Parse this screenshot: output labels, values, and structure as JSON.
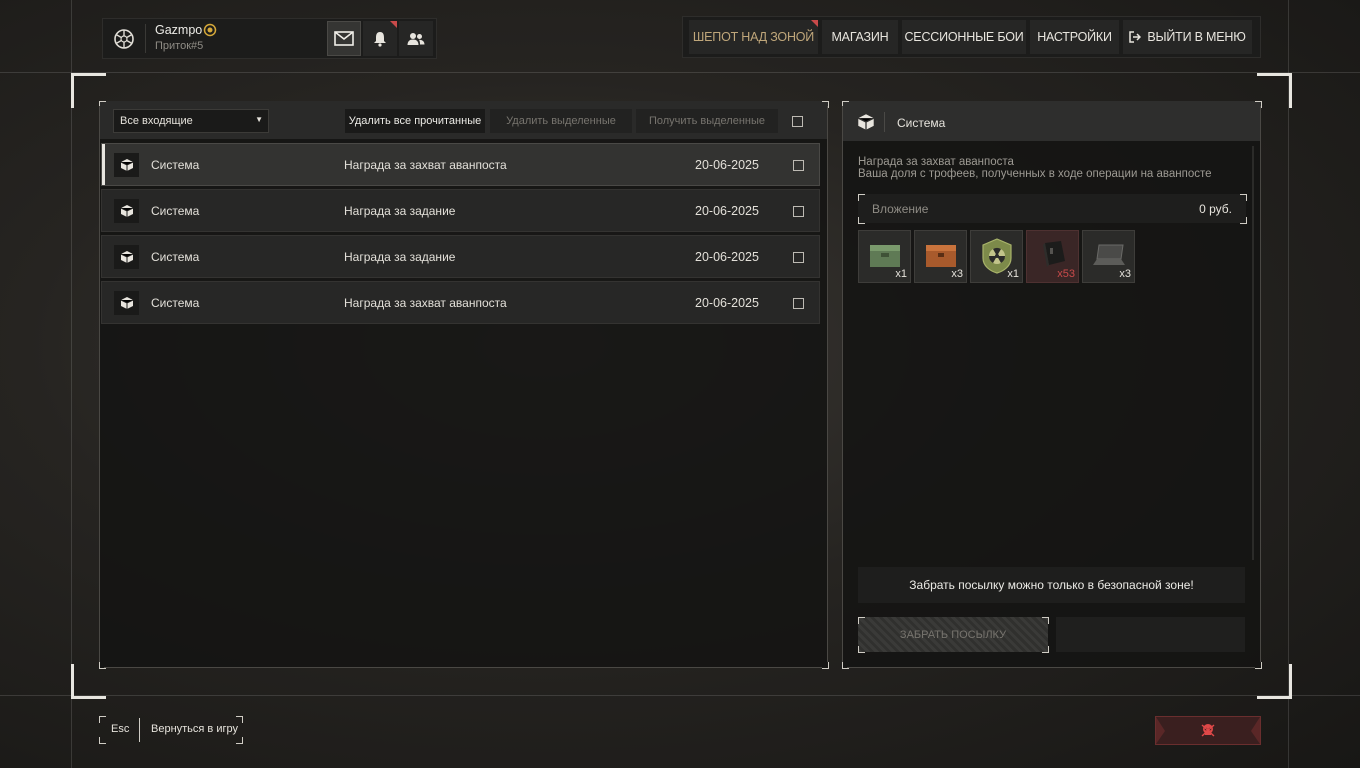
{
  "player": {
    "name": "Gazmpo",
    "group": "Приток#5",
    "icons": {
      "avatar": "faction-emblem-icon",
      "rank": "rank-badge-icon",
      "mail": "mail-icon",
      "bell": "bell-icon",
      "friends": "friends-icon"
    }
  },
  "nav": {
    "items": [
      {
        "label": "ШЕПОТ НАД ЗОНОЙ",
        "active": true
      },
      {
        "label": "МАГАЗИН"
      },
      {
        "label": "СЕССИОННЫЕ БОИ"
      },
      {
        "label": "НАСТРОЙКИ"
      },
      {
        "label": "ВЫЙТИ В МЕНЮ",
        "icon": "exit-icon"
      }
    ]
  },
  "inbox": {
    "filter": "Все входящие",
    "delete_read": "Удалить все прочитанные",
    "delete_selected": "Удалить выделенные",
    "get_selected": "Получить выделенные",
    "messages": [
      {
        "sender": "Система",
        "subject": "Награда за захват аванпоста",
        "date": "20-06-2025",
        "selected": true
      },
      {
        "sender": "Система",
        "subject": "Награда за задание",
        "date": "20-06-2025"
      },
      {
        "sender": "Система",
        "subject": "Награда за задание",
        "date": "20-06-2025"
      },
      {
        "sender": "Система",
        "subject": "Награда за захват аванпоста",
        "date": "20-06-2025"
      }
    ]
  },
  "detail": {
    "sender": "Система",
    "title": "Награда за захват аванпоста",
    "body": "Ваша доля с трофеев, полученных в ходе операции на аванпосте",
    "attachment_label": "Вложение",
    "attachment_value": "0 руб.",
    "items": [
      {
        "icon": "green-ammo-crate-icon",
        "qty": "x1"
      },
      {
        "icon": "orange-crate-icon",
        "qty": "x3"
      },
      {
        "icon": "radiation-badge-icon",
        "qty": "x1"
      },
      {
        "icon": "ammo-box-icon",
        "qty": "x53",
        "alert": true
      },
      {
        "icon": "laptop-icon",
        "qty": "x3"
      }
    ],
    "warning": "Забрать посылку можно только в безопасной зоне!",
    "take_button": "ЗАБРАТЬ ПОСЫЛКУ"
  },
  "footer": {
    "key": "Esc",
    "back_label": "Вернуться в игру",
    "skull_icon": "skull-icon"
  },
  "colors": {
    "accent": "#bfa67a",
    "alert": "#c94a4a"
  }
}
